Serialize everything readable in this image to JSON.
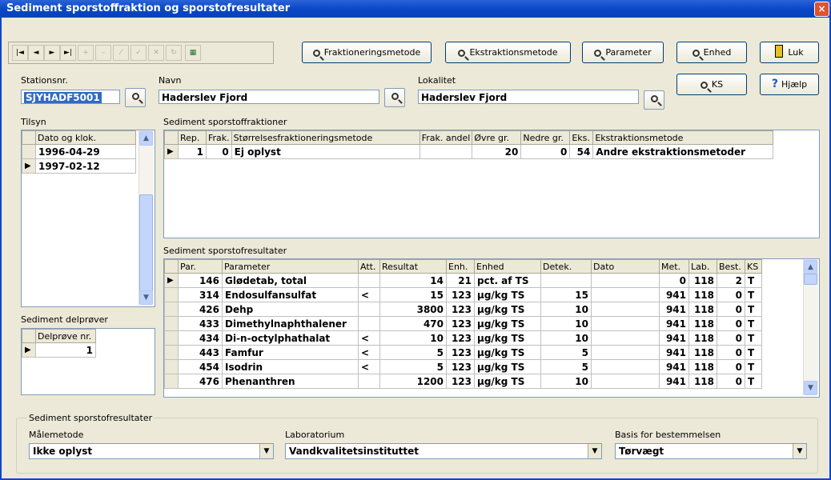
{
  "window": {
    "title": "Sediment sporstoffraktion og sporstofresultater",
    "close": "×"
  },
  "toolbar": {
    "nav": [
      "|◄",
      "◄",
      "►",
      "►|",
      "+",
      "–",
      "⁄",
      "✓",
      "✕",
      "↻",
      "▦"
    ],
    "buttons": [
      "Fraktioneringsmetode",
      "Ekstraktionsmetode",
      "Parameter",
      "Enhed",
      "Luk"
    ],
    "ks": "KS",
    "help": "Hjælp"
  },
  "station": {
    "label": "Stationsnr.",
    "value": "SJYHADF5001"
  },
  "navn": {
    "label": "Navn",
    "value": "Haderslev Fjord"
  },
  "lokalitet": {
    "label": "Lokalitet",
    "value": "Haderslev Fjord"
  },
  "tilsyn": {
    "label": "Tilsyn",
    "header": "Dato og klok.",
    "rows": [
      "1996-04-29",
      "1997-02-12"
    ]
  },
  "delproever": {
    "label": "Sediment delprøver",
    "header": "Delprøve nr.",
    "rows": [
      "1"
    ]
  },
  "fraktioner": {
    "label": "Sediment sporstoffraktioner",
    "headers": [
      "Rep.",
      "Frak.",
      "Størrelsesfraktioneringsmetode",
      "Frak. andel",
      "Øvre gr.",
      "Nedre gr.",
      "Eks.",
      "Ekstraktionsmetode"
    ],
    "rows": [
      [
        "1",
        "0",
        "Ej oplyst",
        "",
        "20",
        "0",
        "54",
        "Andre ekstraktionsmetoder"
      ]
    ]
  },
  "resultater": {
    "label": "Sediment sporstofresultater",
    "headers": [
      "Par.",
      "Parameter",
      "Att.",
      "Resultat",
      "Enh.",
      "Enhed",
      "Detek.",
      "Dato",
      "Met.",
      "Lab.",
      "Best.",
      "KS"
    ],
    "rows": [
      [
        "146",
        "Glødetab, total",
        "",
        "14",
        "21",
        "pct. af TS",
        "",
        "",
        "0",
        "118",
        "2",
        "T"
      ],
      [
        "314",
        "Endosulfansulfat",
        "<",
        "15",
        "123",
        "µg/kg TS",
        "15",
        "",
        "941",
        "118",
        "0",
        "T"
      ],
      [
        "426",
        "Dehp",
        "",
        "3800",
        "123",
        "µg/kg TS",
        "10",
        "",
        "941",
        "118",
        "0",
        "T"
      ],
      [
        "433",
        "Dimethylnaphthalener",
        "",
        "470",
        "123",
        "µg/kg TS",
        "10",
        "",
        "941",
        "118",
        "0",
        "T"
      ],
      [
        "434",
        "Di-n-octylphathalat",
        "<",
        "10",
        "123",
        "µg/kg TS",
        "10",
        "",
        "941",
        "118",
        "0",
        "T"
      ],
      [
        "443",
        "Famfur",
        "<",
        "5",
        "123",
        "µg/kg TS",
        "5",
        "",
        "941",
        "118",
        "0",
        "T"
      ],
      [
        "454",
        "Isodrin",
        "<",
        "5",
        "123",
        "µg/kg TS",
        "5",
        "",
        "941",
        "118",
        "0",
        "T"
      ],
      [
        "476",
        "Phenanthren",
        "",
        "1200",
        "123",
        "µg/kg TS",
        "10",
        "",
        "941",
        "118",
        "0",
        "T"
      ]
    ]
  },
  "bottom": {
    "group": "Sediment sporstofresultater",
    "maalemetode": {
      "label": "Målemetode",
      "value": "Ikke oplyst"
    },
    "laboratorium": {
      "label": "Laboratorium",
      "value": "Vandkvalitetsinstituttet"
    },
    "basis": {
      "label": "Basis for bestemmelsen",
      "value": "Tørvægt"
    }
  }
}
